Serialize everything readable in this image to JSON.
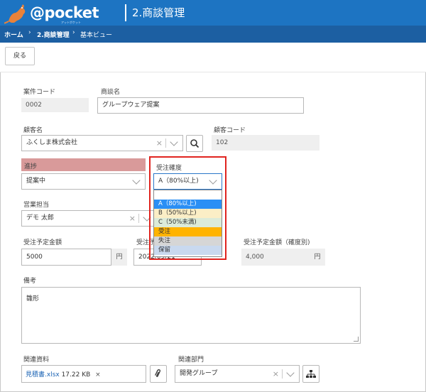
{
  "header": {
    "logo": "@pocket",
    "logo_sub": "アットポケット",
    "title": "2.商談管理"
  },
  "breadcrumb": [
    "ホーム",
    "2.商談管理",
    "基本ビュー"
  ],
  "toolbar": {
    "back_label": "戻る"
  },
  "form": {
    "case_code": {
      "label": "案件コード",
      "value": "0002"
    },
    "deal_name": {
      "label": "商談名",
      "value": "グループウェア提案"
    },
    "customer_name": {
      "label": "顧客名",
      "value": "ふくしま株式会社"
    },
    "customer_code": {
      "label": "顧客コード",
      "value": "102"
    },
    "progress": {
      "label": "進捗",
      "value": "提案中"
    },
    "probability": {
      "label": "受注確度",
      "value": "A（80%以上)"
    },
    "sales_rep": {
      "label": "営業担当",
      "value": "デモ 太郎"
    },
    "order_amount": {
      "label": "受注予定金額",
      "value": "5000",
      "unit": "円"
    },
    "order_date": {
      "label": "受注予",
      "value": "2022/09/21"
    },
    "weighted_amount": {
      "label": "受注予定金額（確度別)",
      "value": "4,000",
      "unit": "円"
    },
    "notes": {
      "label": "備考",
      "value": "雛形"
    },
    "related_docs": {
      "label": "関連資料",
      "file_name": "見積書.xlsx",
      "file_size": "17.22 KB"
    },
    "related_dept": {
      "label": "関連部門",
      "value": "開発グループ"
    }
  },
  "probability_dropdown": {
    "options": [
      {
        "label": "",
        "color": "#ffffff"
      },
      {
        "label": "A（80%以上)",
        "color": "#2a8ff5",
        "text_color": "#ffffff"
      },
      {
        "label": "B（50%以上)",
        "color": "#fbeec6"
      },
      {
        "label": "C（50%未満)",
        "color": "#dcebd9"
      },
      {
        "label": "受注",
        "color": "#ffb300"
      },
      {
        "label": "失注",
        "color": "#d6d6d6"
      },
      {
        "label": "保留",
        "color": "#c9d9ef"
      }
    ]
  },
  "colors": {
    "header": "#1d74c2",
    "breadcrumb": "#1c5fa2",
    "progress_label_bg": "#d99a9a",
    "highlight_box": "#e0241f"
  }
}
